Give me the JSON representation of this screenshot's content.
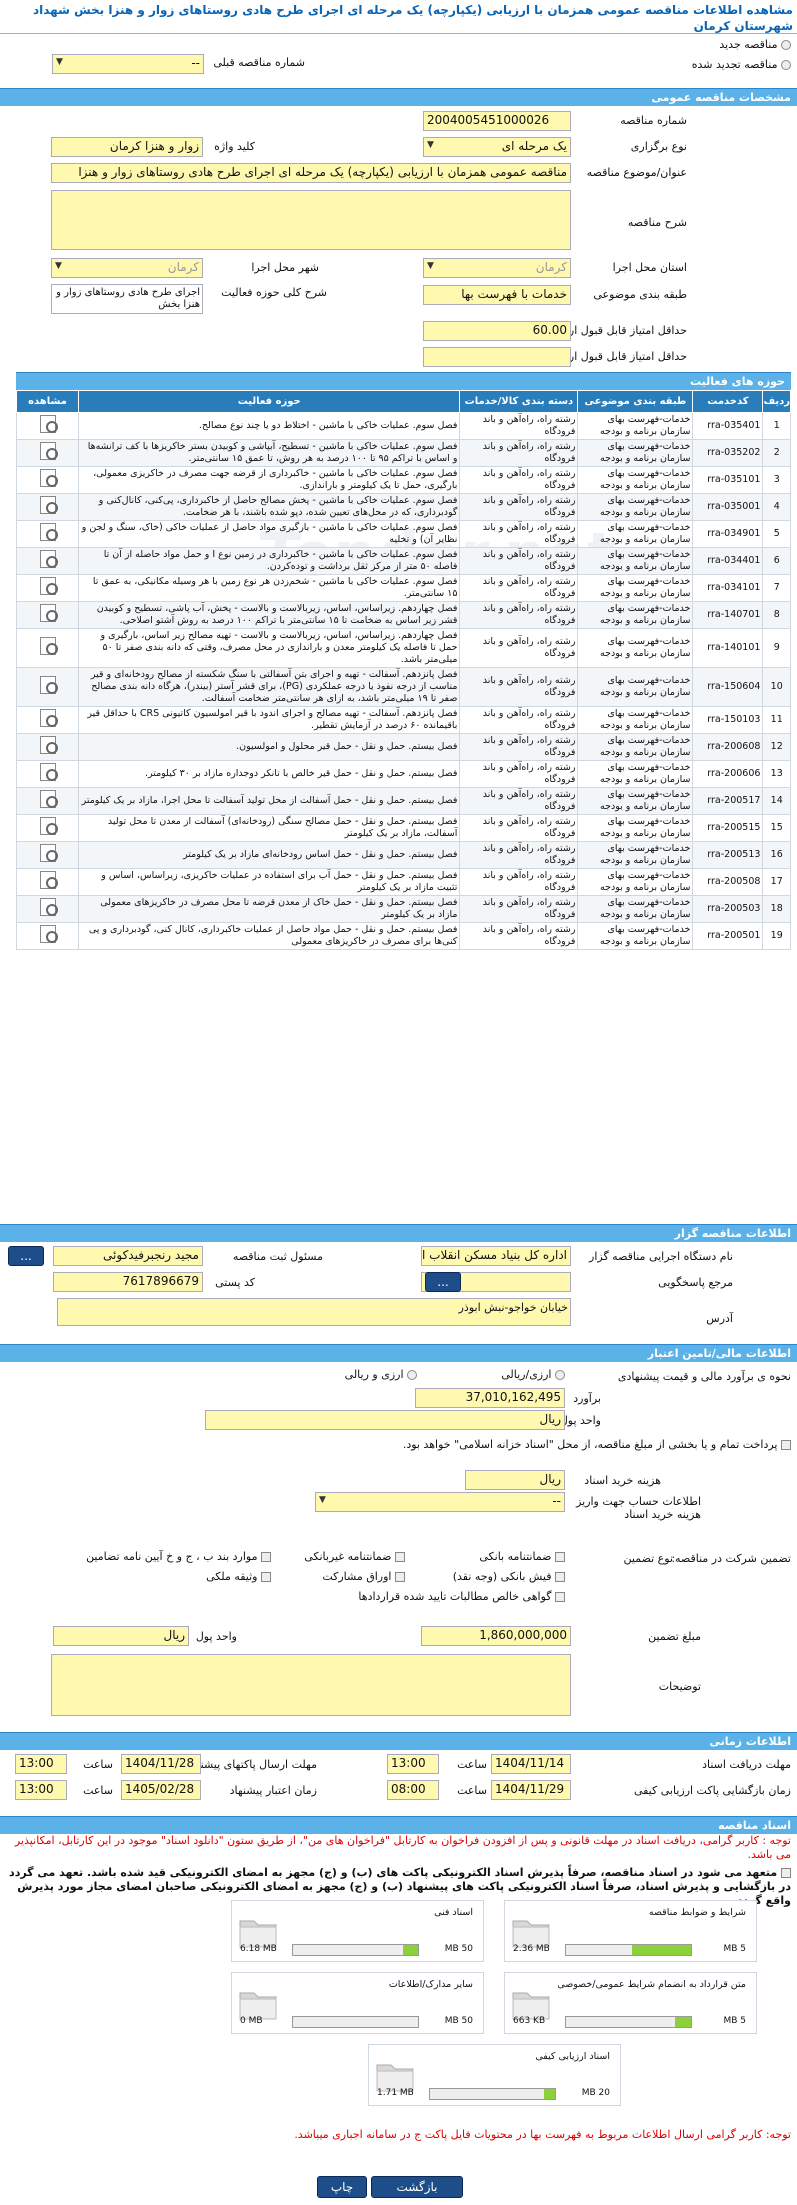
{
  "page_title": "مشاهده اطلاعات مناقصه عمومی همزمان با ارزیابی (یکپارچه) یک مرحله ای اجرای طرح هادی روستاهای زوار و هنزا بخش شهداد شهرستان کرمان",
  "top": {
    "new_label": "مناقصه جدید",
    "renew_label": "مناقصه تجدید شده",
    "prev_no_label": "شماره مناقصه قبلی",
    "prev_no_value": "--"
  },
  "general": {
    "header": "مشخصات مناقصه عمومی",
    "no_label": "شماره مناقصه",
    "no_value": "2004005451000026",
    "type_label": "نوع برگزاری",
    "type_value": "یک مرحله ای",
    "keyword_label": "کلید واژه",
    "keyword_value": "زوار و هنزا کرمان",
    "subject_label": "عنوان/موضوع مناقصه",
    "subject_value": "مناقصه عمومی همزمان با ارزیابی (یکپارچه) یک مرحله ای اجرای طرح هادی روستاهای زوار و هنزا",
    "desc_label": "شرح مناقصه",
    "province_label": "استان محل اجرا",
    "province_value": "کرمان",
    "city_label": "شهر محل اجرا",
    "city_value": "کرمان",
    "class_label": "طبقه بندی موضوعی",
    "class_value": "خدمات با فهرست بها",
    "scope_label": "شرح کلی حوزه فعالیت",
    "scope_value": "اجرای طرح هادی روستاهای زوار و هنزا بخش",
    "min_quality_label": "حداقل امتیاز قابل قبول ارزیابی کیفی",
    "min_quality_value": "60.00",
    "min_tech_label": "حداقل امتیاز قابل قبول ارزیابی فنی/بازرگانی"
  },
  "activity": {
    "header": "حوزه های فعالیت",
    "cols": [
      "ردیف",
      "کدخدمت",
      "طبقه بندی موضوعی",
      "دسته بندی کالا/خدمات",
      "حوزه فعالیت",
      "مشاهده"
    ],
    "rows": [
      [
        "1",
        "rra-035401",
        "خدمات-فهرست بهای سازمان برنامه و بودجه",
        "رشته راه، راه‌آهن و باند فرودگاه",
        "فصل سوم. عملیات خاکی با ماشین - اختلاط دو یا چند نوع مصالح."
      ],
      [
        "2",
        "rra-035202",
        "خدمات-فهرست بهای سازمان برنامه و بودجه",
        "رشته راه، راه‌آهن و باند فرودگاه",
        "فصل سوم. عملیات خاکی با ماشین - تسطیح، آبپاشی و کوبیدن بستر خاکریزها با کف ترانشه‌ها و اساس با تراکم ۹۵ تا ۱۰۰ درصد به هر روش، تا عمق ۱۵ سانتی‌متر."
      ],
      [
        "3",
        "rra-035101",
        "خدمات-فهرست بهای سازمان برنامه و بودجه",
        "رشته راه، راه‌آهن و باند فرودگاه",
        "فصل سوم. عملیات خاکی با ماشین - خاکبرداری از قرضه جهت مصرف در خاکریزی معمولی، بارگیری، حمل تا یک کیلومتر و باراندازی."
      ],
      [
        "4",
        "rra-035001",
        "خدمات-فهرست بهای سازمان برنامه و بودجه",
        "رشته راه، راه‌آهن و باند فرودگاه",
        "فصل سوم. عملیات خاکی با ماشین - پخش مصالح حاصل از خاکبرداری، پی‌کنی، کانال‌کنی و گودبرداری، که در محل‌های تعیین شده، دپو شده باشند، با هر ضخامت."
      ],
      [
        "5",
        "rra-034901",
        "خدمات-فهرست بهای سازمان برنامه و بودجه",
        "رشته راه، راه‌آهن و باند فرودگاه",
        "فصل سوم. عملیات خاکی با ماشین - بارگیری مواد حاصل از عملیات خاکی (خاک، سنگ و لجن و نظایر آن) و تخلیه"
      ],
      [
        "6",
        "rra-034401",
        "خدمات-فهرست بهای سازمان برنامه و بودجه",
        "رشته راه، راه‌آهن و باند فرودگاه",
        "فصل سوم. عملیات خاکی با ماشین - خاکبرداری در زمین نوع I و حمل مواد حاصله از آن تا فاصله ۵۰ متر از مرکز ثقل برداشت و توده‌کردن."
      ],
      [
        "7",
        "rra-034101",
        "خدمات-فهرست بهای سازمان برنامه و بودجه",
        "رشته راه، راه‌آهن و باند فرودگاه",
        "فصل سوم. عملیات خاکی با ماشین - شخم‌زدن هر نوع زمین با هر وسیله مکانیکی، به عمق تا ۱۵ سانتی‌متر."
      ],
      [
        "8",
        "rra-140701",
        "خدمات-فهرست بهای سازمان برنامه و بودجه",
        "رشته راه، راه‌آهن و باند فرودگاه",
        "فصل چهاردهم. زیراساس، اساس، زیربالاست و بالاست - پخش، آب پاشی، تسطیح و کوبیدن قشر زیر اساس به ضخامت تا ۱۵ سانتی‌متر با تراکم ۱۰۰ درصد به روش آشتو اصلاحی."
      ],
      [
        "9",
        "rra-140101",
        "خدمات-فهرست بهای سازمان برنامه و بودجه",
        "رشته راه، راه‌آهن و باند فرودگاه",
        "فصل چهاردهم. زیراساس، اساس، زیربالاست و بالاست - تهیه مصالح زیر اساس، بارگیری و حمل تا فاصله یک کیلومتر معدن و باراندازی در محل مصرف، وقتی که دانه بندی صفر تا ۵۰ میلی‌متر باشد."
      ],
      [
        "10",
        "rra-150604",
        "خدمات-فهرست بهای سازمان برنامه و بودجه",
        "رشته راه، راه‌آهن و باند فرودگاه",
        "فصل پانزدهم. آسفالت - تهیه و اجرای بتن آسفالتی با سنگ شکسته از مصالح رودخانه‌ای و قیر مناسب از درجه نفوذ یا درجه عملکردی (PG)، برای قشر آستر (بیندر)، هرگاه دانه بندی مصالح صفر تا ۱۹ میلی‌متر باشد، به ازای هر سانتی‌متر ضخامت آسفالت."
      ],
      [
        "11",
        "rra-150103",
        "خدمات-فهرست بهای سازمان برنامه و بودجه",
        "رشته راه، راه‌آهن و باند فرودگاه",
        "فصل پانزدهم. آسفالت - تهیه مصالح و اجرای اندود با قیر امولسیون کاتیونی CRS با حداقل قیر باقیمانده ۶۰ درصد در آزمایش تقطیر."
      ],
      [
        "12",
        "rra-200608",
        "خدمات-فهرست بهای سازمان برنامه و بودجه",
        "رشته راه، راه‌آهن و باند فرودگاه",
        "فصل بیستم. حمل و نقل - حمل قیر محلول و امولسیون."
      ],
      [
        "13",
        "rra-200606",
        "خدمات-فهرست بهای سازمان برنامه و بودجه",
        "رشته راه، راه‌آهن و باند فرودگاه",
        "فصل بیستم. حمل و نقل - حمل قیر خالص با تانکر دوجداره مازاد بر ۳۰ کیلومتر."
      ],
      [
        "14",
        "rra-200517",
        "خدمات-فهرست بهای سازمان برنامه و بودجه",
        "رشته راه، راه‌آهن و باند فرودگاه",
        "فصل بیستم. حمل و نقل - حمل آسفالت از محل تولید آسفالت تا محل اجرا، مازاد بر یک کیلومتر"
      ],
      [
        "15",
        "rra-200515",
        "خدمات-فهرست بهای سازمان برنامه و بودجه",
        "رشته راه، راه‌آهن و باند فرودگاه",
        "فصل بیستم. حمل و نقل - حمل مصالح سنگی (رودخانه‌ای) آسفالت از معدن تا محل تولید آسفالت، مازاد بر یک کیلومتر"
      ],
      [
        "16",
        "rra-200513",
        "خدمات-فهرست بهای سازمان برنامه و بودجه",
        "رشته راه، راه‌آهن و باند فرودگاه",
        "فصل بیستم. حمل و نقل - حمل اساس رودخانه‌ای مازاد بر یک کیلومتر"
      ],
      [
        "17",
        "rra-200508",
        "خدمات-فهرست بهای سازمان برنامه و بودجه",
        "رشته راه، راه‌آهن و باند فرودگاه",
        "فصل بیستم. حمل و نقل - حمل آب برای استفاده در عملیات خاکریزی، زیراساس، اساس و تثبیت مازاد بر یک کیلومتر"
      ],
      [
        "18",
        "rra-200503",
        "خدمات-فهرست بهای سازمان برنامه و بودجه",
        "رشته راه، راه‌آهن و باند فرودگاه",
        "فصل بیستم. حمل و نقل - حمل خاک از معدن قرضه تا محل مصرف در خاکریزهای معمولی مازاد بر یک کیلومتر"
      ],
      [
        "19",
        "rra-200501",
        "خدمات-فهرست بهای سازمان برنامه و بودجه",
        "رشته راه، راه‌آهن و باند فرودگاه",
        "فصل بیستم. حمل و نقل - حمل مواد حاصل از عملیات خاکبرداری، کانال کنی، گودبرداری و پی کنی‌ها برای مصرف در خاکریزهای معمولی"
      ]
    ]
  },
  "organizer": {
    "header": "اطلاعات مناقصه گزار",
    "org_label": "نام دستگاه اجرایی مناقصه گزار",
    "org_value": "اداره کل بنیاد مسکن انقلاب اسلامی استان کرمان",
    "resp_label": "مسئول ثبت مناقصه",
    "resp_value": "مجید رنجبرفیدکوئی",
    "ref_label": "مرجع پاسخگویی",
    "postal_label": "کد پستی",
    "postal_value": "7617896679",
    "address_label": "آدرس",
    "address_value": "خیابان خواجو-نبش ابوذر",
    "dots": "..."
  },
  "finance": {
    "header": "اطلاعات مالی/تامین اعتبار",
    "estimate_type_label": "نحوه ی برآورد مالی و قیمت پیشنهادی",
    "opt_rial": "ارزی/ریالی",
    "opt_fx": "ارزی و ریالی",
    "estimate_label": "برآورد",
    "estimate_value": "37,010,162,495",
    "unit_label": "واحد پول",
    "unit_value": "ریال",
    "payment_text": "پرداخت تمام و یا بخشی از مبلغ مناقصه، از محل \"اسناد خزانه اسلامی\" خواهد بود.",
    "doc_fee_label": "هزینه خرید اسناد",
    "doc_fee_unit": "ریال",
    "account_label": "اطلاعات حساب جهت واریز هزینه خرید اسناد",
    "account_value": "--"
  },
  "guarantee": {
    "type_label": "نوع تضمین",
    "header_label": "تضمین شرکت در مناقصه:",
    "options": [
      "ضمانتنامه بانکی",
      "ضمانتنامه غیربانکی",
      "موارد بند ب ، ج و خ آیین نامه تضامین",
      "فیش بانکی (وجه نقد)",
      "اوراق مشارکت",
      "وثیقه ملکی",
      "گواهی خالص مطالبات تایید شده قراردادها"
    ],
    "amount_label": "مبلغ تضمین",
    "amount_value": "1,860,000,000",
    "unit_label": "واحد پول",
    "unit_value": "ریال",
    "notes_label": "توضیحات"
  },
  "timing": {
    "header": "اطلاعات زمانی",
    "receive_label": "مهلت دریافت اسناد",
    "receive_date": "1404/11/14",
    "receive_time": "13:00",
    "send_label": "مهلت ارسال پاکتهای پیشنهادی",
    "send_date": "1404/11/28",
    "send_time": "13:00",
    "open_label": "زمان بازگشایی پاکت ارزیابی کیفی",
    "open_date": "1404/11/29",
    "open_time": "08:00",
    "valid_label": "زمان اعتبار پیشنهاد",
    "valid_date": "1405/02/28",
    "valid_time": "13:00",
    "time_word": "ساعت"
  },
  "docs": {
    "header": "اسناد مناقصه",
    "note1": "توجه : کاربر گرامی، دریافت اسناد در مهلت قانونی و پس از افزودن فراخوان به کارتابل \"فراخوان های من\"، از طریق ستون \"دانلود اسناد\" موجود در این کارتابل، امکانپذیر می باشد.",
    "note2": "متعهد می شود در اسناد مناقصه، صرفاً پذیرش اسناد الکترونیکی پاکت های (ب) و (ج) مجهز به امضای الکترونیکی قید شده باشد. تعهد می گردد در بازگشایی و پذیرش اسناد، صرفاً اسناد الکترونیکی پاکت های پیشنهاد (ب) و (ج) مجهز به امضای الکترونیکی صاحبان امضای مجاز مورد پذیرش واقع گردد.",
    "items": [
      {
        "name": "شرایط و ضوابط مناقصه",
        "used": "2.36 MB",
        "max": "5 MB",
        "fill": 0.47
      },
      {
        "name": "اسناد فنی",
        "used": "6.18 MB",
        "max": "50 MB",
        "fill": 0.12
      },
      {
        "name": "متن قرارداد به انضمام شرایط عمومی/خصوصی",
        "used": "663 KB",
        "max": "5 MB",
        "fill": 0.13
      },
      {
        "name": "سایر مدارک/اطلاعات",
        "used": "0 MB",
        "max": "50 MB",
        "fill": 0
      },
      {
        "name": "اسناد ارزیابی کیفی",
        "used": "1.71 MB",
        "max": "20 MB",
        "fill": 0.09
      }
    ],
    "note3": "توجه: کاربر گرامی ارسال اطلاعات مربوط به فهرست بها در محتویات فایل پاکت ج در سامانه اجباری میباشد."
  },
  "footer": {
    "print": "چاپ",
    "back": "بازگشت"
  },
  "watermark": "Tender.net"
}
